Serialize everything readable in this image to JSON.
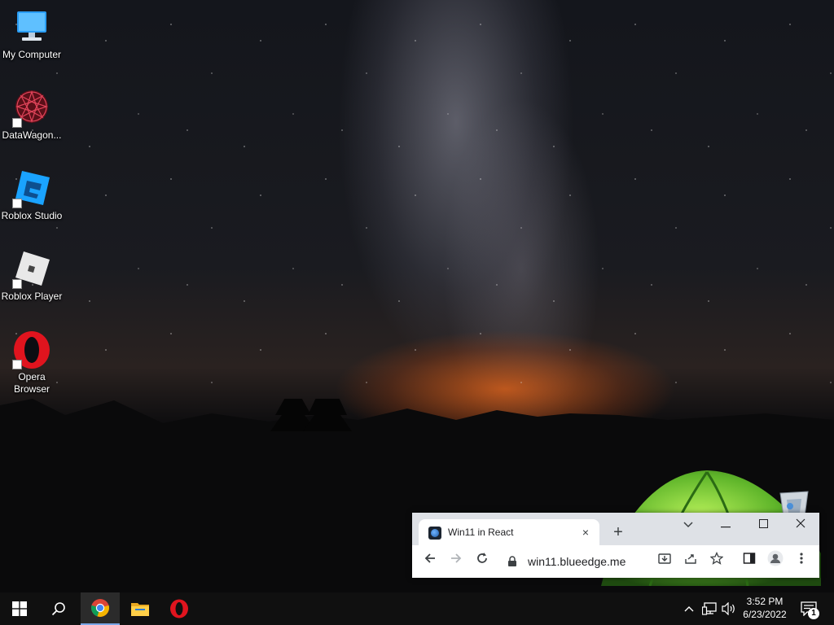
{
  "desktop": {
    "icons": [
      {
        "label": "My Computer",
        "icon": "computer-icon"
      },
      {
        "label": "DataWagon...",
        "icon": "datawagon-icon"
      },
      {
        "label": "Roblox Studio",
        "icon": "roblox-studio-icon"
      },
      {
        "label": "Roblox Player",
        "icon": "roblox-player-icon"
      },
      {
        "label": "Opera Browser",
        "icon": "opera-icon"
      }
    ],
    "recycle_bin_icon": "recycle-bin-icon"
  },
  "browser": {
    "tab_title": "Win11 in React",
    "tab_close": "×",
    "new_tab": "+",
    "url": "win11.blueedge.me",
    "window_controls": {
      "tab_search": "⌄",
      "minimize": "–",
      "maximize": "□",
      "close": "✕"
    }
  },
  "taskbar": {
    "time": "3:52 PM",
    "date": "6/23/2022",
    "notification_count": "1",
    "accent": "#7aa7e8"
  }
}
